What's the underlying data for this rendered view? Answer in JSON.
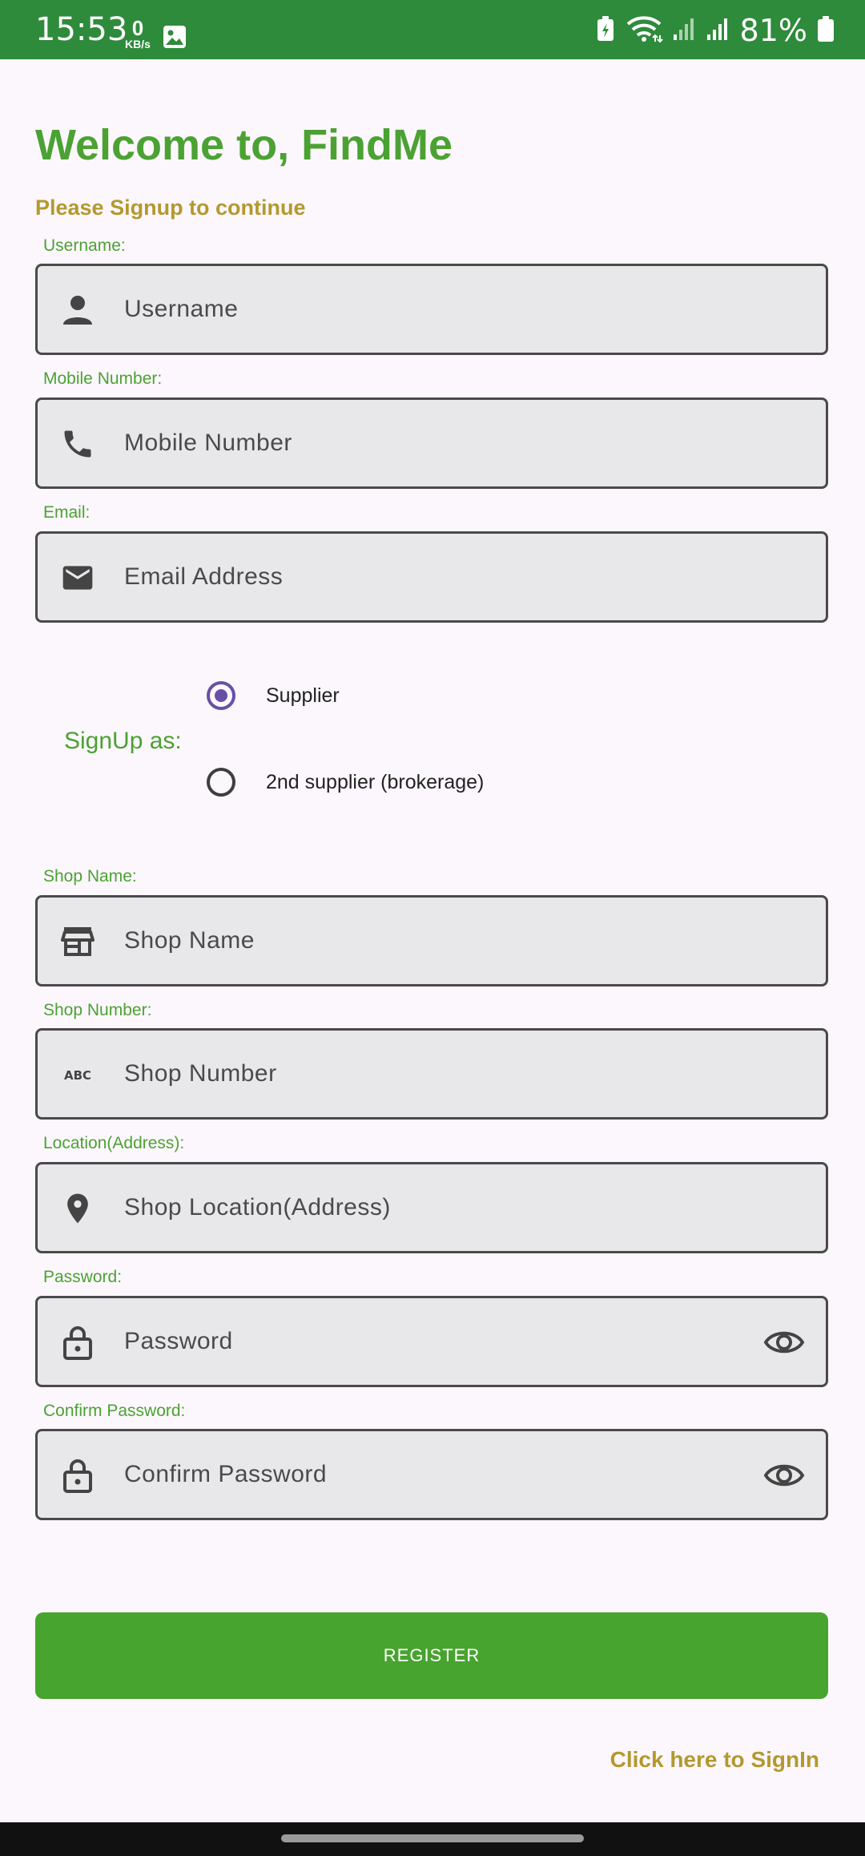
{
  "status_bar": {
    "time": "15:53",
    "net_speed_value": "0",
    "net_speed_unit": "KB/s",
    "battery_percent": "81%",
    "icons": [
      "image-icon",
      "battery-saver-icon",
      "wifi-icon",
      "signal-icon",
      "signal-icon",
      "battery-icon"
    ]
  },
  "header": {
    "title": "Welcome to, FindMe",
    "subtitle": "Please Signup to continue"
  },
  "form": {
    "username": {
      "label": "Username:",
      "placeholder": "Username",
      "icon": "person-icon"
    },
    "mobile": {
      "label": "Mobile Number:",
      "placeholder": "Mobile Number",
      "icon": "phone-icon"
    },
    "email": {
      "label": "Email:",
      "placeholder": "Email Address",
      "icon": "mail-icon"
    },
    "signup_as": {
      "label": "SignUp as:",
      "options": [
        {
          "label": "Supplier",
          "selected": true
        },
        {
          "label": "2nd supplier (brokerage)",
          "selected": false
        }
      ]
    },
    "shop_name": {
      "label": "Shop Name:",
      "placeholder": "Shop Name",
      "icon": "store-icon"
    },
    "shop_number": {
      "label": "Shop Number:",
      "placeholder": "Shop Number",
      "icon": "abc-icon"
    },
    "location": {
      "label": "Location(Address):",
      "placeholder": "Shop Location(Address)",
      "icon": "location-pin-icon"
    },
    "password": {
      "label": "Password:",
      "placeholder": "Password",
      "icon": "lock-icon",
      "toggle_icon": "eye-icon"
    },
    "confirm_password": {
      "label": "Confirm Password:",
      "placeholder": "Confirm Password",
      "icon": "lock-icon",
      "toggle_icon": "eye-icon"
    }
  },
  "actions": {
    "register_label": "REGISTER",
    "signin_link": "Click here to SignIn"
  },
  "colors": {
    "status_bar": "#2E8B3B",
    "accent_green": "#4BA233",
    "accent_gold": "#B3992E",
    "radio_selected": "#6750A4",
    "field_bg": "#E8E8EA",
    "background": "#FCF7FC"
  }
}
